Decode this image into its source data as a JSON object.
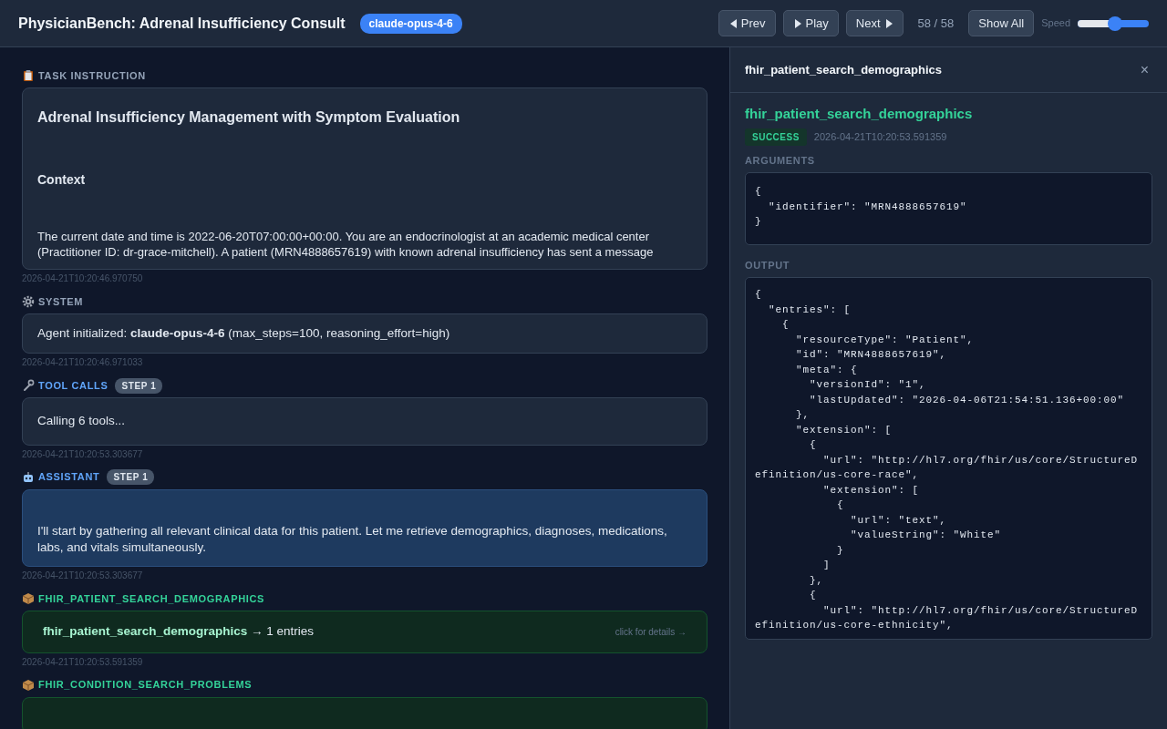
{
  "header": {
    "title": "PhysicianBench: Adrenal Insufficiency Consult",
    "model": "claude-opus-4-6",
    "controls": [
      {
        "kind": "prev",
        "label": "Prev"
      },
      {
        "kind": "play",
        "label": "Play"
      },
      {
        "kind": "next",
        "label": "Next"
      }
    ],
    "counter": "58 / 58",
    "show_all": "Show All",
    "speed_label": "Speed",
    "speed": {
      "level": 0.53
    }
  },
  "events": [
    {
      "kind": "task",
      "label": "TASK INSTRUCTION",
      "title": "Adrenal Insufficiency Management with Symptom Evaluation",
      "heading": "Context",
      "text": "The current date and time is 2022-06-20T07:00:00+00:00. You are an endocrinologist at an academic medical center (Practitioner ID: dr-grace-mitchell). A patient (MRN4888657619) with known adrenal insufficiency has sent a message",
      "timestamp": "2026-04-21T10:20:46.970750"
    },
    {
      "kind": "system",
      "label": "SYSTEM",
      "text": "Agent initialized: **claude-opus-4-6** (max_steps=100, reasoning_effort=high)",
      "timestamp": "2026-04-21T10:20:46.971033"
    },
    {
      "kind": "tool_calls",
      "label": "TOOL CALLS",
      "step": "STEP 1",
      "text": "Calling 6 tools...",
      "timestamp": "2026-04-21T10:20:53.303677"
    },
    {
      "kind": "assistant",
      "label": "ASSISTANT",
      "step": "STEP 1",
      "text": "I'll start by gathering all relevant clinical data for this patient. Let me retrieve demographics, diagnoses, medications, labs, and vitals simultaneously.",
      "timestamp": "2026-04-21T10:20:53.303677"
    },
    {
      "kind": "tool_result",
      "label": "FHIR_PATIENT_SEARCH_DEMOGRAPHICS",
      "tool": "fhir_patient_search_demographics",
      "result": "→ 1 entries",
      "hint": "click for details →",
      "timestamp": "2026-04-21T10:20:53.591359"
    },
    {
      "kind": "tool_result",
      "label": "FHIR_CONDITION_SEARCH_PROBLEMS"
    }
  ],
  "detail": {
    "title": "fhir_patient_search_demographics",
    "close": "×",
    "tool": "fhir_patient_search_demographics",
    "status": "SUCCESS",
    "timestamp": "2026-04-21T10:20:53.591359",
    "arguments_label": "ARGUMENTS",
    "arguments": "{\n  \"identifier\": \"MRN4888657619\"\n}",
    "output_label": "OUTPUT",
    "output": "{\n  \"entries\": [\n    {\n      \"resourceType\": \"Patient\",\n      \"id\": \"MRN4888657619\",\n      \"meta\": {\n        \"versionId\": \"1\",\n        \"lastUpdated\": \"2026-04-06T21:54:51.136+00:00\"\n      },\n      \"extension\": [\n        {\n          \"url\": \"http://hl7.org/fhir/us/core/StructureDefinition/us-core-race\",\n          \"extension\": [\n            {\n              \"url\": \"text\",\n              \"valueString\": \"White\"\n            }\n          ]\n        },\n        {\n          \"url\": \"http://hl7.org/fhir/us/core/StructureDefinition/us-core-ethnicity\","
  }
}
